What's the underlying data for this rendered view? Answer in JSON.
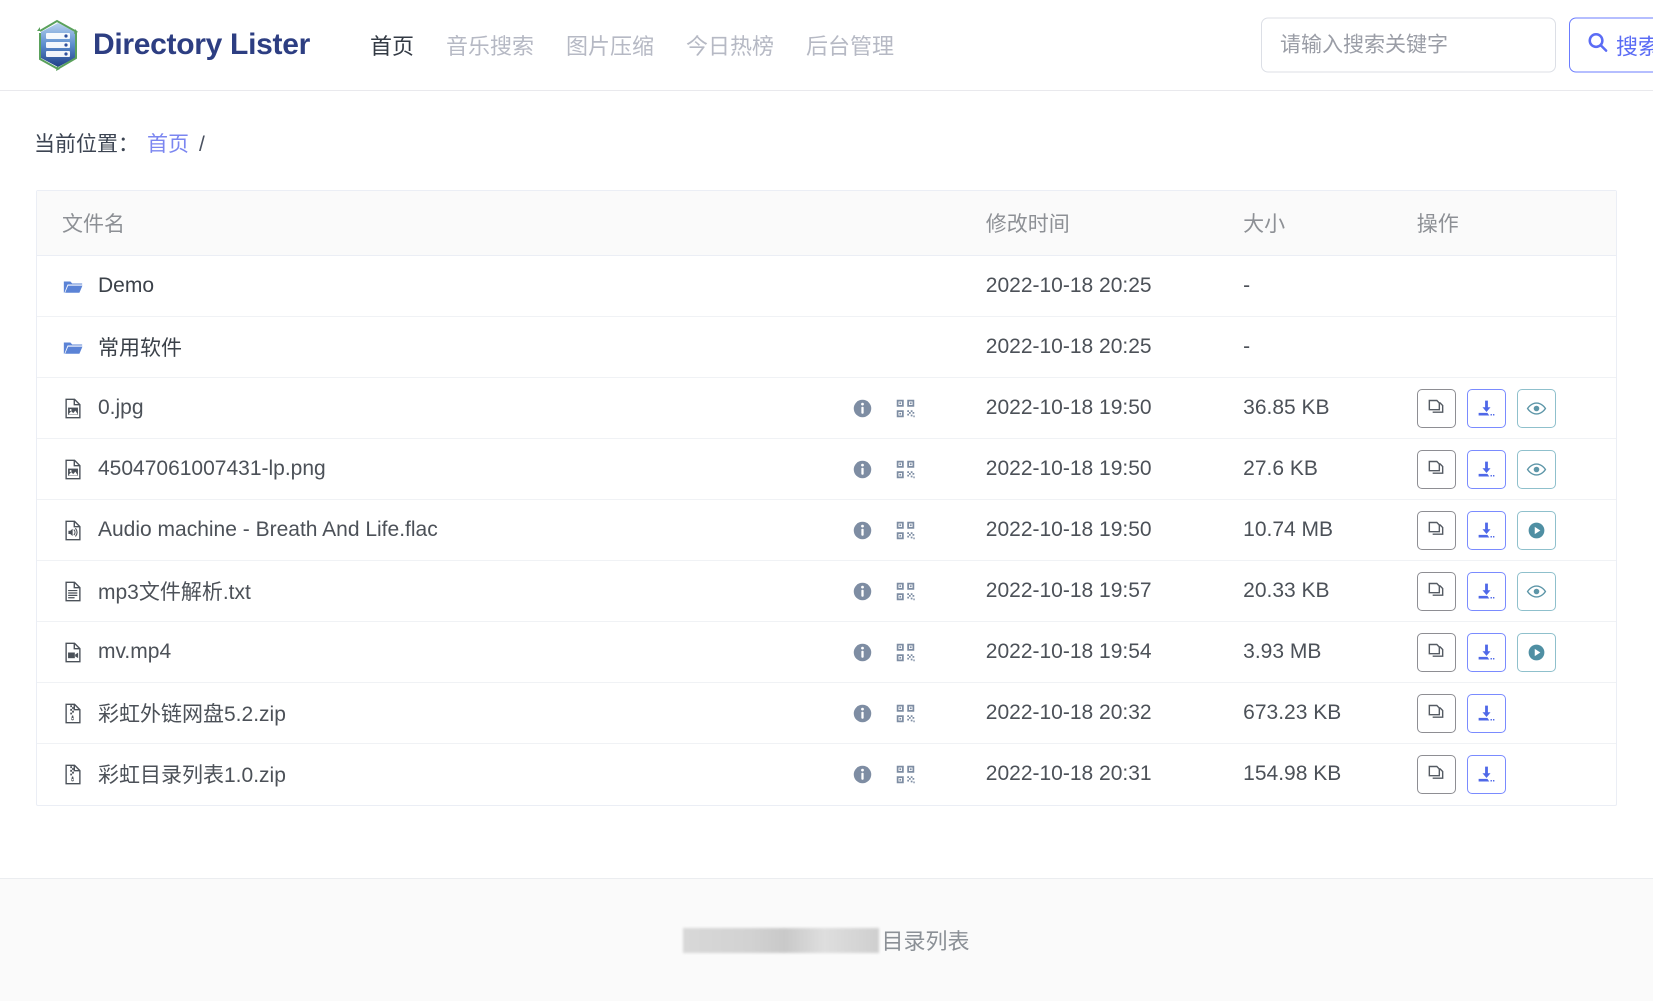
{
  "header": {
    "brand_name": "Directory Lister",
    "logo_icon": "server-stack-hexagon-icon",
    "nav": [
      {
        "label": "首页",
        "active": true
      },
      {
        "label": "音乐搜索",
        "active": false
      },
      {
        "label": "图片压缩",
        "active": false
      },
      {
        "label": "今日热榜",
        "active": false
      },
      {
        "label": "后台管理",
        "active": false
      }
    ],
    "search": {
      "placeholder": "请输入搜索关键字",
      "value": "",
      "button_label": "搜索",
      "button_icon": "search-icon"
    }
  },
  "breadcrumb": {
    "label": "当前位置：",
    "link": "首页",
    "separator": "/"
  },
  "table": {
    "columns": {
      "name": "文件名",
      "time": "修改时间",
      "size": "大小",
      "ops": "操作"
    },
    "rows": [
      {
        "name": "Demo",
        "icon": "folder-icon",
        "time": "2022-10-18 20:25",
        "size": "-",
        "has_info": false,
        "has_qr": false,
        "ops": []
      },
      {
        "name": "常用软件",
        "icon": "folder-icon",
        "time": "2022-10-18 20:25",
        "size": "-",
        "has_info": false,
        "has_qr": false,
        "ops": []
      },
      {
        "name": "0.jpg",
        "icon": "image-icon",
        "time": "2022-10-18 19:50",
        "size": "36.85 KB",
        "has_info": true,
        "has_qr": true,
        "ops": [
          "copy",
          "download",
          "view"
        ]
      },
      {
        "name": "45047061007431-lp.png",
        "icon": "image-icon",
        "time": "2022-10-18 19:50",
        "size": "27.6 KB",
        "has_info": true,
        "has_qr": true,
        "ops": [
          "copy",
          "download",
          "view"
        ]
      },
      {
        "name": "Audio machine - Breath And Life.flac",
        "icon": "audio-icon",
        "time": "2022-10-18 19:50",
        "size": "10.74 MB",
        "has_info": true,
        "has_qr": true,
        "ops": [
          "copy",
          "download",
          "play"
        ]
      },
      {
        "name": "mp3文件解析.txt",
        "icon": "text-icon",
        "time": "2022-10-18 19:57",
        "size": "20.33 KB",
        "has_info": true,
        "has_qr": true,
        "ops": [
          "copy",
          "download",
          "view"
        ]
      },
      {
        "name": "mv.mp4",
        "icon": "video-icon",
        "time": "2022-10-18 19:54",
        "size": "3.93 MB",
        "has_info": true,
        "has_qr": true,
        "ops": [
          "copy",
          "download",
          "play"
        ]
      },
      {
        "name": "彩虹外链网盘5.2.zip",
        "icon": "archive-icon",
        "time": "2022-10-18 20:32",
        "size": "673.23 KB",
        "has_info": true,
        "has_qr": true,
        "ops": [
          "copy",
          "download"
        ]
      },
      {
        "name": "彩虹目录列表1.0.zip",
        "icon": "archive-icon",
        "time": "2022-10-18 20:31",
        "size": "154.98 KB",
        "has_info": true,
        "has_qr": true,
        "ops": [
          "copy",
          "download"
        ]
      }
    ]
  },
  "footer": {
    "redacted": true,
    "text": "目录列表"
  },
  "colors": {
    "brand": "#2d3e82",
    "accent": "#5b6cf5",
    "link": "#7b86f0",
    "folder": "#5b83d6",
    "view": "#5d96a8",
    "muted": "#8d9095"
  }
}
